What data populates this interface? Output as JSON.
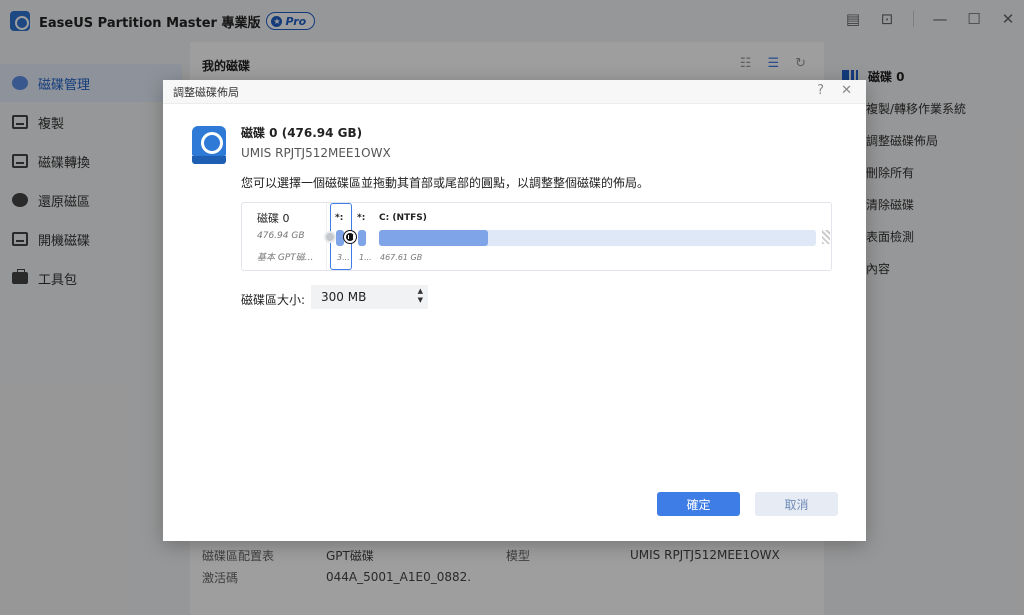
{
  "app": {
    "title": "EaseUS Partition Master 專業版",
    "badge": "Pro"
  },
  "sidebar": {
    "items": [
      {
        "label": "磁碟管理",
        "icon": "pie-chart-icon",
        "active": true
      },
      {
        "label": "複製",
        "icon": "clone-icon"
      },
      {
        "label": "磁碟轉換",
        "icon": "convert-icon"
      },
      {
        "label": "還原磁區",
        "icon": "recover-icon"
      },
      {
        "label": "開機磁碟",
        "icon": "boot-disk-icon"
      },
      {
        "label": "工具包",
        "icon": "toolkit-icon"
      }
    ]
  },
  "main": {
    "title": "我的磁碟",
    "info": {
      "row1": {
        "k1": "磁碟區配置表",
        "v1": "GPT磁碟",
        "k2": "模型",
        "v2": "UMIS RPJTJ512MEE1OWX"
      },
      "row2": {
        "k1": "激活碼",
        "v1": "044A_5001_A1E0_0882."
      }
    }
  },
  "rightpanel": {
    "title": "磁碟 0",
    "items": [
      "複製/轉移作業系統",
      "調整磁碟佈局",
      "刪除所有",
      "清除磁碟",
      "表面檢測",
      "內容"
    ]
  },
  "dialog": {
    "title": "調整磁碟佈局",
    "disk_title": "磁碟 0 (476.94 GB)",
    "disk_model": "UMIS RPJTJ512MEE1OWX",
    "instruction": "您可以選擇一個磁碟區並拖動其首部或尾部的圓點，以調整整個磁碟的佈局。",
    "layout": {
      "disk_name": "磁碟 0",
      "disk_size": "476.94 GB",
      "disk_type": "基本 GPT磁...",
      "partitions": [
        {
          "label": "*:",
          "sub": "3...",
          "fill": 1.0
        },
        {
          "label": "*:",
          "sub": "1...",
          "fill": 1.0
        },
        {
          "label": "C: (NTFS)",
          "sub": "467.61 GB",
          "fill": 0.25
        }
      ]
    },
    "size_label": "磁碟區大小:",
    "size_value": "300 MB",
    "ok_label": "確定",
    "cancel_label": "取消"
  },
  "colors": {
    "accent": "#3f7de6",
    "bar_fill": "#7fa4e8",
    "bar_track": "#dfe8f6"
  }
}
